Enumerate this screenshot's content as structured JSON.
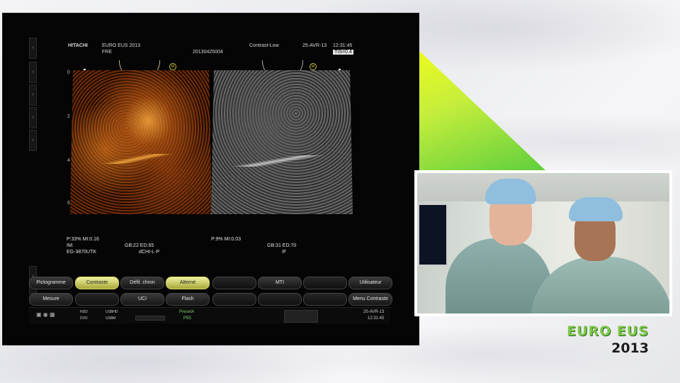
{
  "header": {
    "brand": "HITACHI",
    "event": "EURO EUS 2013",
    "lang": "FRE",
    "study_id": "20130425004",
    "mode": "Contrast-Low",
    "date": "25-AVR-13",
    "time": "12:31:45",
    "tis": "TIS=0.4"
  },
  "depth_ticks": [
    "0",
    "2",
    "4",
    "6"
  ],
  "left_params": {
    "line1": "P:33%   MI:0.16",
    "line2": "IM:",
    "line3": "EG-3870UTK",
    "gb": "GB:22   ED:65",
    "mode": "dCHI-L-P"
  },
  "right_params": {
    "line1": "P:9%    MI:0.03",
    "gb": "GB:31   ED:70",
    "mode": "IF"
  },
  "buttons_row1": [
    "Pictogramme",
    "Contraste",
    "Défil. chron",
    "Alterné",
    "",
    "MTI",
    "",
    "Utilisateur"
  ],
  "buttons_row2": [
    "Mesure",
    "",
    "UCI",
    "Flash",
    "",
    "",
    "",
    "Menu Contraste"
  ],
  "status": {
    "hdd": "HDD",
    "dvd": "DVD",
    "usbhd": "USBHD",
    "usbm": "USBM",
    "preset": "PresetA",
    "preset_sub": "P55",
    "date": "25-AVR-13",
    "time": "12:31:45"
  },
  "logo": {
    "line1": "EURO EUS",
    "line2": "2013"
  },
  "colors": {
    "accent_green": "#7ec84a",
    "active_button": "#e0e08a",
    "scan_orange": "#d27a25"
  }
}
